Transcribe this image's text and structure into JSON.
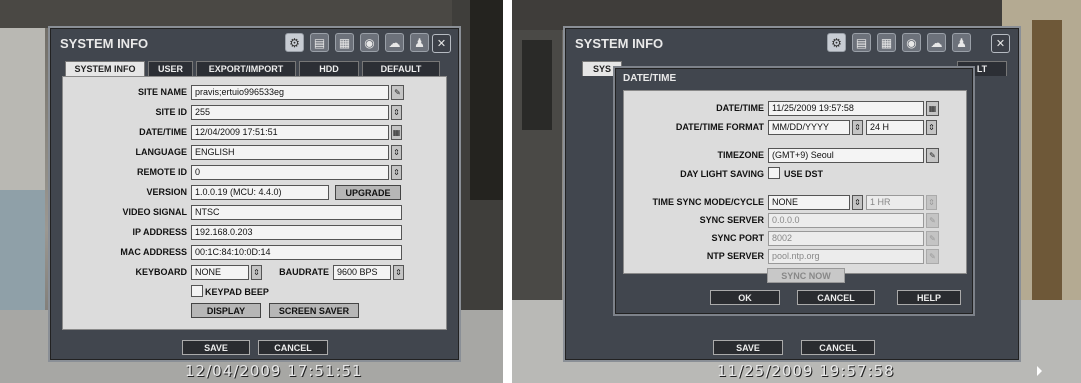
{
  "left": {
    "window_title": "SYSTEM INFO",
    "timestamp": "12/04/2009 17:51:51",
    "tabs": [
      "SYSTEM INFO",
      "USER",
      "EXPORT/IMPORT",
      "HDD",
      "DEFAULT"
    ],
    "fields": {
      "site_name_label": "SITE NAME",
      "site_name": "pravis;ertuio996533eg",
      "site_id_label": "SITE ID",
      "site_id": "255",
      "datetime_label": "DATE/TIME",
      "datetime": "12/04/2009 17:51:51",
      "language_label": "LANGUAGE",
      "language": "ENGLISH",
      "remote_id_label": "REMOTE ID",
      "remote_id": "0",
      "version_label": "VERSION",
      "version": "1.0.0.19 (MCU: 4.4.0)",
      "upgrade": "UPGRADE",
      "video_signal_label": "VIDEO SIGNAL",
      "video_signal": "NTSC",
      "ip_label": "IP ADDRESS",
      "ip": "192.168.0.203",
      "mac_label": "MAC ADDRESS",
      "mac": "00:1C:84:10:0D:14",
      "keyboard_label": "KEYBOARD",
      "keyboard": "NONE",
      "baudrate_label": "BAUDRATE",
      "baudrate": "9600 BPS",
      "keypad_beep": "KEYPAD BEEP",
      "display": "DISPLAY",
      "screen_saver": "SCREEN SAVER"
    },
    "save": "SAVE",
    "cancel": "CANCEL"
  },
  "right": {
    "window_title": "SYSTEM INFO",
    "timestamp": "11/25/2009 19:57:58",
    "tab_partial_left": "SYS",
    "tab_partial_right": "LT",
    "popup_title": "DATE/TIME",
    "fields": {
      "datetime_label": "DATE/TIME",
      "datetime": "11/25/2009 19:57:58",
      "format_label": "DATE/TIME FORMAT",
      "date_format": "MM/DD/YYYY",
      "time_format": "24 H",
      "timezone_label": "TIMEZONE",
      "timezone": "(GMT+9) Seoul",
      "dst_label": "DAY LIGHT SAVING",
      "use_dst": "USE DST",
      "sync_mode_label": "TIME SYNC MODE/CYCLE",
      "sync_mode": "NONE",
      "sync_cycle": "1 HR",
      "sync_server_label": "SYNC SERVER",
      "sync_server": "0.0.0.0",
      "sync_port_label": "SYNC PORT",
      "sync_port": "8002",
      "ntp_server_label": "NTP SERVER",
      "ntp_server": "pool.ntp.org",
      "sync_now": "SYNC NOW"
    },
    "ok": "OK",
    "popup_cancel": "CANCEL",
    "help": "HELP",
    "save": "SAVE",
    "cancel": "CANCEL"
  }
}
